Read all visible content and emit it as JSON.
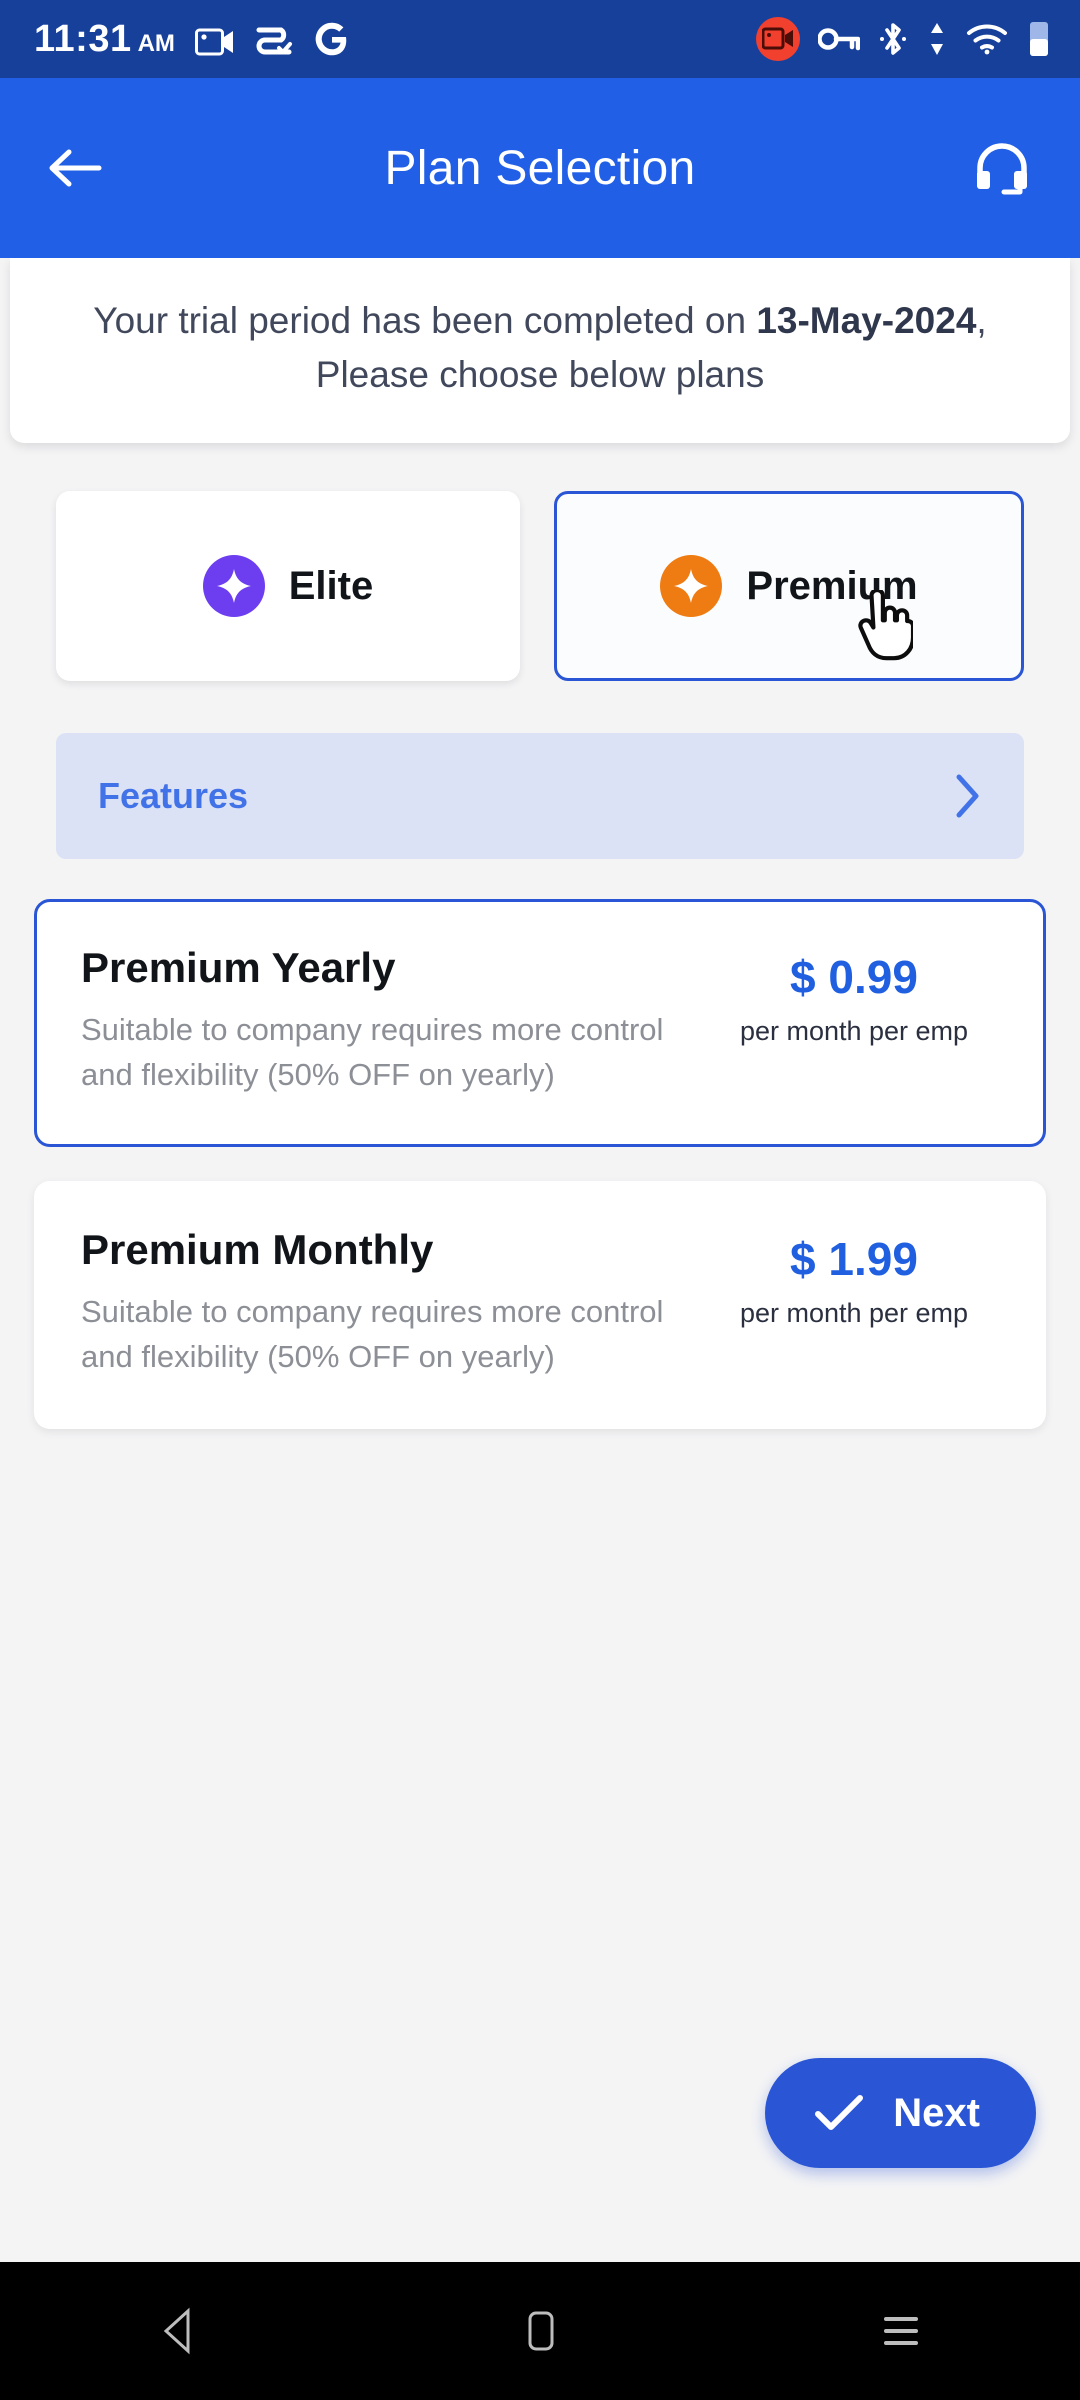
{
  "status_bar": {
    "time": "11:31",
    "meridiem": "AM",
    "left_icons": [
      "screen-record-icon",
      "zoom-app-icon",
      "google-icon"
    ],
    "right_icons": [
      "screen-record-active-icon",
      "vpn-key-icon",
      "bluetooth-icon",
      "mobile-data-icon",
      "wifi-icon",
      "battery-icon"
    ],
    "background_color": "#17409b"
  },
  "app_bar": {
    "title": "Plan Selection",
    "back_icon": "arrow-left-icon",
    "support_icon": "headset-icon",
    "background_color": "#2160e6"
  },
  "notice": {
    "prefix": "Your trial period has been completed on ",
    "date": "13-May-2024",
    "suffix": ", Please choose below plans"
  },
  "plan_tabs": [
    {
      "label": "Elite",
      "icon": "sparkle-icon",
      "color": "#6d3ef0",
      "selected": false
    },
    {
      "label": "Premium",
      "icon": "sparkle-icon",
      "color": "#ef7c12",
      "selected": true
    }
  ],
  "features_bar": {
    "label": "Features",
    "chevron_icon": "chevron-right-icon",
    "background_color": "#dbe2f5",
    "text_color": "#4272e8"
  },
  "plans": [
    {
      "name": "Premium Yearly",
      "description": "Suitable to company requires more control and flexibility (50% OFF on yearly)",
      "price": "$ 0.99",
      "unit": "per month per emp",
      "selected": true
    },
    {
      "name": "Premium Monthly",
      "description": "Suitable to company requires more control and flexibility (50% OFF on yearly)",
      "price": "$ 1.99",
      "unit": "per month per emp",
      "selected": false
    }
  ],
  "next_button": {
    "label": "Next",
    "icon": "check-icon",
    "color": "#2a56d6"
  },
  "nav_bar": {
    "back_icon": "triangle-back-icon",
    "home_icon": "home-square-icon",
    "recents_icon": "recents-menu-icon"
  },
  "cursor": {
    "icon": "pointer-hand-cursor"
  }
}
